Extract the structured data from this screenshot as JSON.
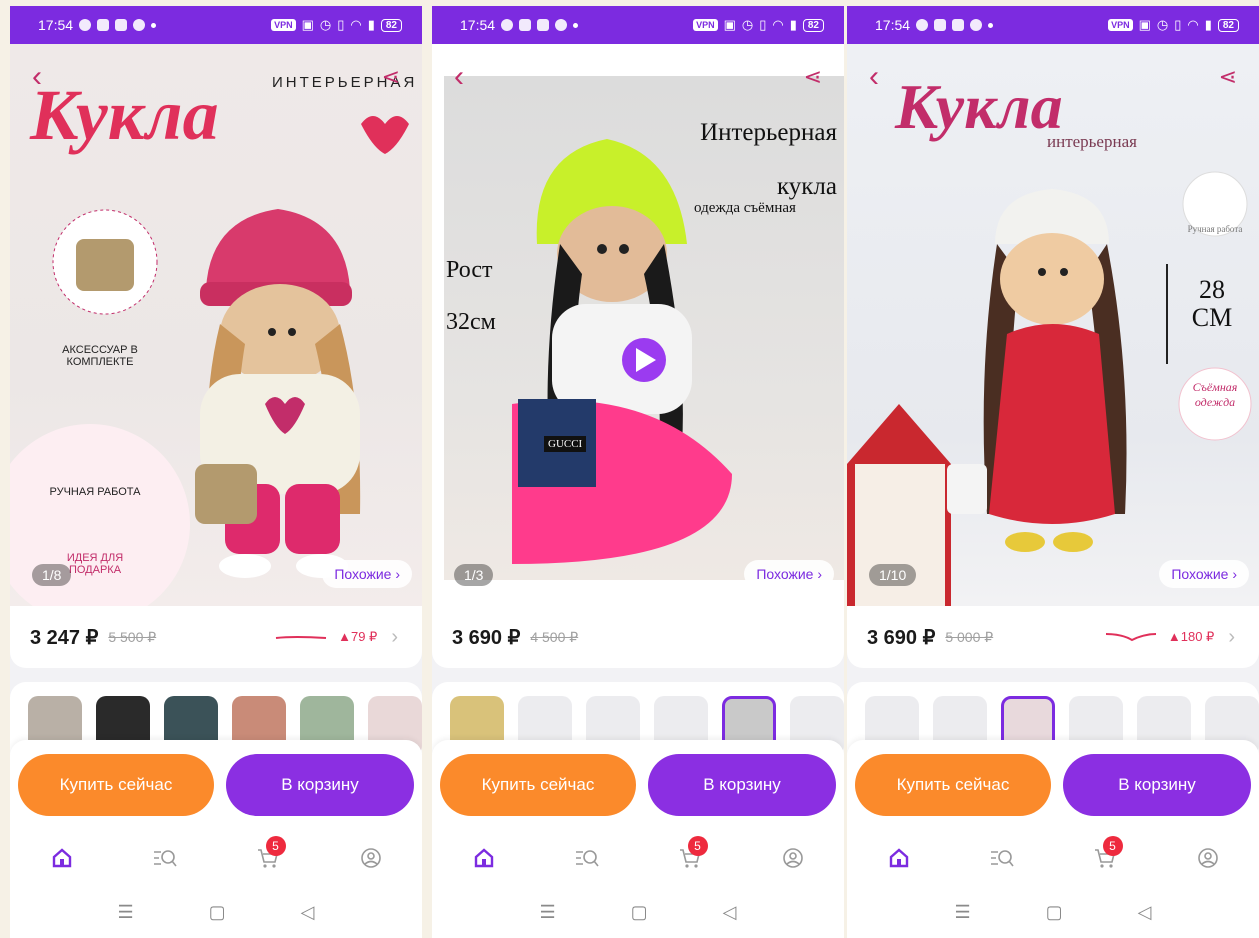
{
  "status_bar": {
    "time": "17:54",
    "vpn": "VPN",
    "battery": "82"
  },
  "screens": [
    {
      "image": {
        "headline": "Кукла",
        "subtitle": "ИНТЕРЬЕРНАЯ",
        "badge_accessory": "АКСЕССУАР В КОМПЛЕКТЕ",
        "badge_handmade": "РУЧНАЯ РАБОТА",
        "badge_gift": "ИДЕЯ ДЛЯ ПОДАРКА",
        "counter": "1/8",
        "similar_label": "Похожие ›"
      },
      "price": {
        "current": "3 247 ₽",
        "old": "5 500 ₽",
        "diff": "▲79 ₽"
      }
    },
    {
      "image": {
        "headline": "Интерьерная кукла",
        "subtitle": "одежда съёмная",
        "height_label": "Рост 32см",
        "bag_label": "GUCCI",
        "counter": "1/3",
        "similar_label": "Похожие ›"
      },
      "price": {
        "current": "3 690 ₽",
        "old": "4 500 ₽",
        "diff": ""
      }
    },
    {
      "image": {
        "headline": "Кукла",
        "subtitle": "интерьерная",
        "badge_handmade": "Ручная работа",
        "height_label": "28 СМ",
        "badge_clothes": "Съёмная одежда",
        "counter": "1/10",
        "similar_label": "Похожие ›"
      },
      "price": {
        "current": "3 690 ₽",
        "old": "5 000 ₽",
        "diff": "▲180 ₽"
      }
    }
  ],
  "actions": {
    "buy_now": "Купить сейчас",
    "add_to_cart": "В корзину"
  },
  "bottom_nav": {
    "cart_badge": "5"
  },
  "colors": {
    "brand": "#7c2be0",
    "buy": "#fb8a2b",
    "cart": "#8b2fe2",
    "accent": "#c22d6a"
  }
}
